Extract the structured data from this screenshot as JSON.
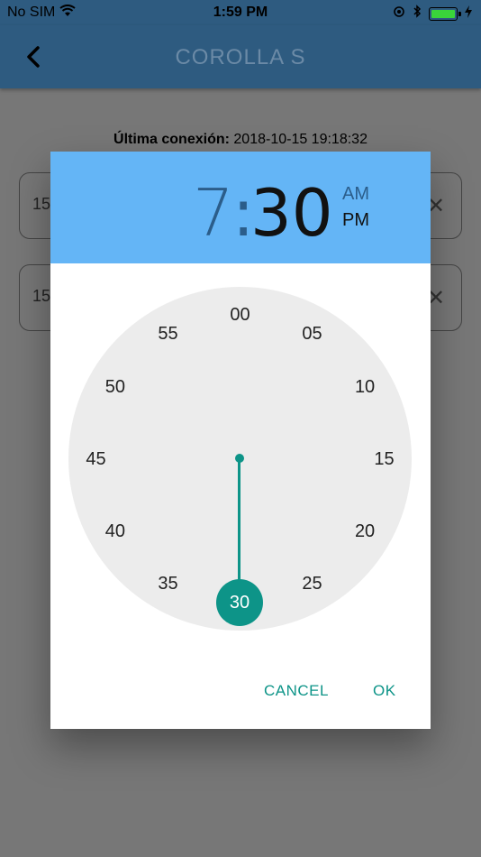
{
  "status_bar": {
    "carrier": "No SIM",
    "time": "1:59 PM"
  },
  "nav": {
    "title": "COROLLA  S",
    "back_icon": "chevron-left-icon"
  },
  "page": {
    "last_connection_label": "Última conexión:",
    "last_connection_value": "2018-10-15 19:18:32",
    "fields": [
      {
        "value": "15",
        "clear_icon": "close-icon"
      },
      {
        "value": "15",
        "clear_icon": "close-icon"
      }
    ]
  },
  "dialog": {
    "header_color": "#64b5f6",
    "accent_color": "#0d9488",
    "hour": "7",
    "colon": ":",
    "minute": "30",
    "am": "AM",
    "pm": "PM",
    "selected_period": "PM",
    "clock_numbers": [
      "00",
      "05",
      "10",
      "15",
      "20",
      "25",
      "30",
      "35",
      "40",
      "45",
      "50",
      "55"
    ],
    "selected_minute": "30",
    "cancel_label": "CANCEL",
    "ok_label": "OK"
  }
}
